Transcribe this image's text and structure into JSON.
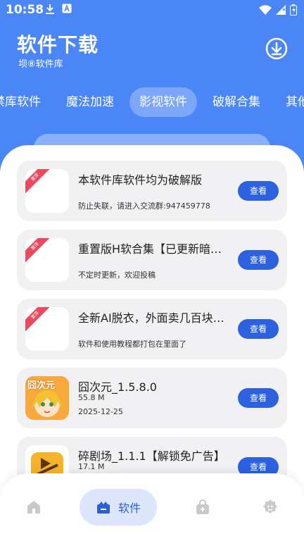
{
  "status_bar": {
    "time": "10:58"
  },
  "header": {
    "title": "软件下载",
    "subtitle": "坝⑧软件库"
  },
  "tabs": [
    {
      "label": "禁库软件"
    },
    {
      "label": "魔法加速"
    },
    {
      "label": "影视软件",
      "active": true
    },
    {
      "label": "破解合集"
    },
    {
      "label": "其他软件"
    }
  ],
  "items": [
    {
      "title": "本软件库软件均为破解版",
      "desc": "防止失联，请进入交流群:947459778",
      "ribbon": "置顶",
      "button": "查看"
    },
    {
      "title": "重置版H软合集【已更新暗网禁区】",
      "desc": "不定时更新，欢迎投稿",
      "ribbon": "置顶",
      "button": "查看"
    },
    {
      "title": "全新AI脱衣，外面卖几百块的那种",
      "desc": "软件和使用教程都打包在里面了",
      "ribbon": "置顶",
      "button": "查看"
    },
    {
      "title": "囧次元_1.5.8.0",
      "size": "55.8 M",
      "date": "2025-12-25",
      "icon_text": "囧次元",
      "button": "查看"
    },
    {
      "title": "碎剧场_1.1.1【解锁免广告】",
      "size": "17.1 M",
      "button": "查看"
    }
  ],
  "bottom_nav": {
    "home_icon": "home-icon",
    "software_label": "软件",
    "bag_icon": "bag-icon",
    "profile_icon": "profile-icon"
  },
  "colors": {
    "primary": "#4a86f5",
    "button": "#2c62e0",
    "ribbon": "#e84a5f",
    "nav_active_bg": "#dce7fd"
  }
}
